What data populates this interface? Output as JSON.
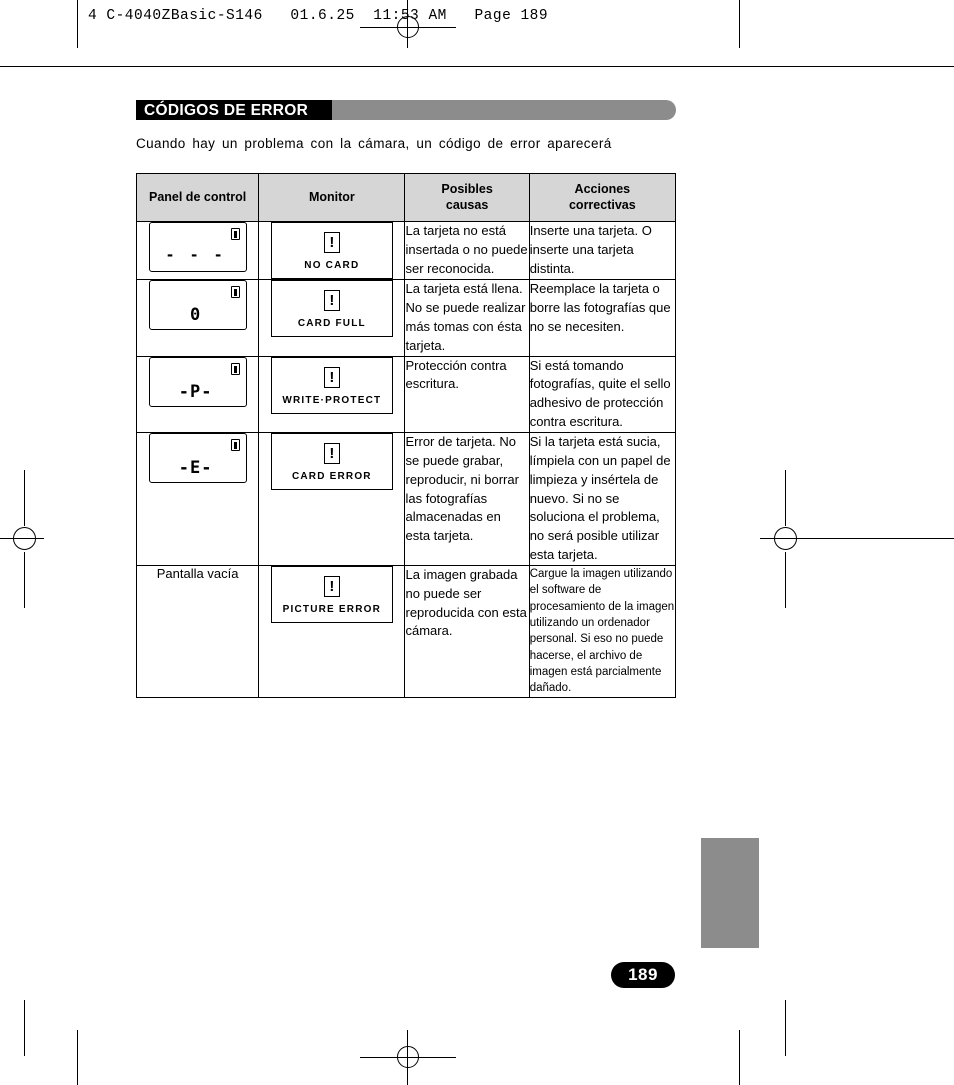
{
  "slug": "4 C-4040ZBasic-S146   01.6.25  11:53 AM   Page 189",
  "section": {
    "title": "CÓDIGOS DE ERROR",
    "intro": "Cuando hay un problema con la cámara, un código de error aparecerá"
  },
  "table": {
    "headers": [
      "Panel de control",
      "Monitor",
      "Posibles\ncausas",
      "Acciones\ncorrectivas"
    ],
    "rows": [
      {
        "panel_segment": "- - -",
        "panel_battery_icon": "battery-icon",
        "monitor_icon": "warning-exclamation-icon",
        "monitor_label": "NO  CARD",
        "cause": "La tarjeta no está insertada o no puede ser reconocida.",
        "action": "Inserte una tarjeta. O inserte una tarjeta distinta."
      },
      {
        "panel_segment": "0",
        "panel_battery_icon": "battery-icon",
        "monitor_icon": "warning-exclamation-icon",
        "monitor_label": "CARD  FULL",
        "cause": "La tarjeta está llena. No se puede realizar más tomas con ésta tarjeta.",
        "action": "Reemplace la tarjeta o borre las fotografías que no se necesiten."
      },
      {
        "panel_segment": "-P-",
        "panel_battery_icon": "battery-icon",
        "monitor_icon": "warning-exclamation-icon",
        "monitor_label": "WRITE·PROTECT",
        "cause": "Protección contra escritura.",
        "action": "Si está tomando fotografías, quite el sello adhesivo de protección contra escritura."
      },
      {
        "panel_segment": "-E-",
        "panel_battery_icon": "battery-icon",
        "monitor_icon": "warning-exclamation-icon",
        "monitor_label": "CARD  ERROR",
        "cause": "Error de tarjeta. No se puede grabar, reproducir, ni borrar las fotografías almacenadas en esta tarjeta.",
        "action": "Si la tarjeta está sucia, límpiela con un papel de limpieza y insértela de nuevo. Si no se soluciona el problema, no será posible utilizar esta tarjeta."
      },
      {
        "panel_text": "Pantalla vacía",
        "monitor_icon": "warning-exclamation-icon",
        "monitor_label": "PICTURE  ERROR",
        "cause": "La imagen grabada no puede ser reproducida con esta cámara.",
        "action": "Cargue la imagen utilizando el software de procesamiento de la imagen utilizando un ordenador personal. Si eso no puede hacerse, el archivo de imagen está parcialmente dañado."
      }
    ]
  },
  "page_number": "189"
}
